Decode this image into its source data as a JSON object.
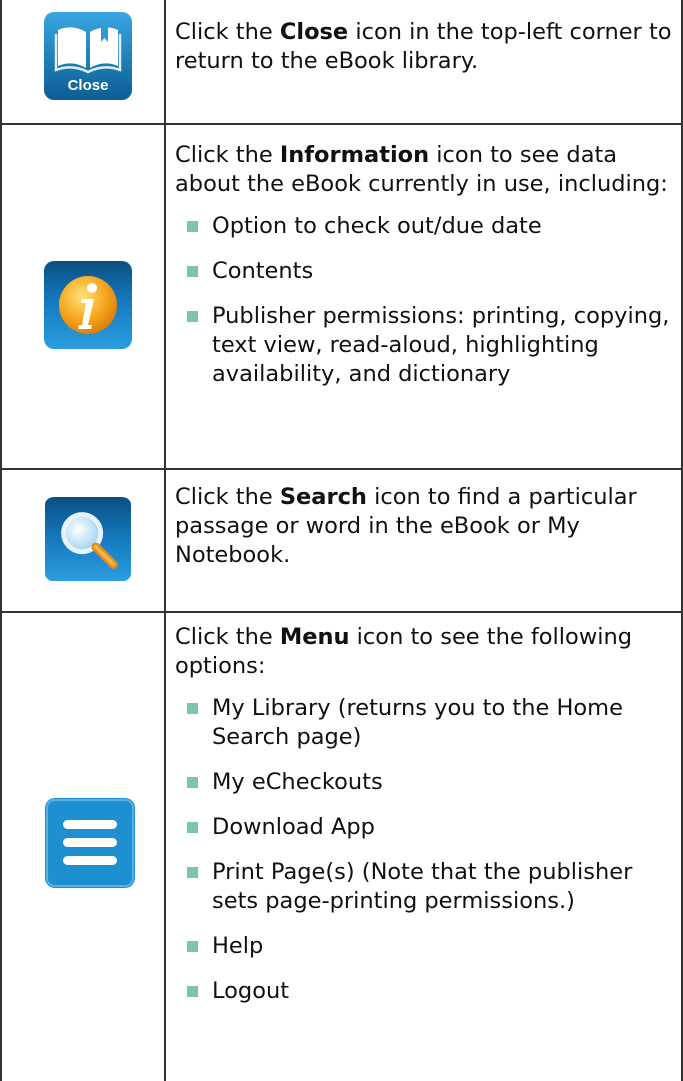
{
  "rows": [
    {
      "icon": "close-book-icon",
      "icon_label": "Close",
      "text_before": "Click the ",
      "keyword": "Close",
      "text_after": " icon in the top-left corner to return to the eBook library."
    },
    {
      "icon": "information-icon",
      "text_before": "Click the ",
      "keyword": "Information",
      "text_after": " icon to see data about the eBook currently in use, including:",
      "bullets": [
        "Option to check out/due date",
        "Contents",
        "Publisher permissions: printing, copying, text view, read-aloud, highlighting availability, and dictionary"
      ]
    },
    {
      "icon": "search-magnifier-icon",
      "text_before": "Click the ",
      "keyword": "Search",
      "text_after": " icon to find a particular passage or word in the eBook or My Notebook."
    },
    {
      "icon": "menu-hamburger-icon",
      "text_before": "Click the ",
      "keyword": "Menu",
      "text_after": " icon to see the following options:",
      "bullets": [
        "My Library (returns you to the Home Search page)",
        "My eCheckouts",
        "Download App",
        "Print Page(s) (Note that the publisher sets page-printing permissions.)",
        "Help",
        "Logout"
      ]
    }
  ],
  "colors": {
    "icon_blue_dark": "#0b5e93",
    "icon_blue_light": "#2f9ad8",
    "menu_blue": "#1e8fd0",
    "bullet_green": "#7cc5a6",
    "border": "#333333"
  }
}
